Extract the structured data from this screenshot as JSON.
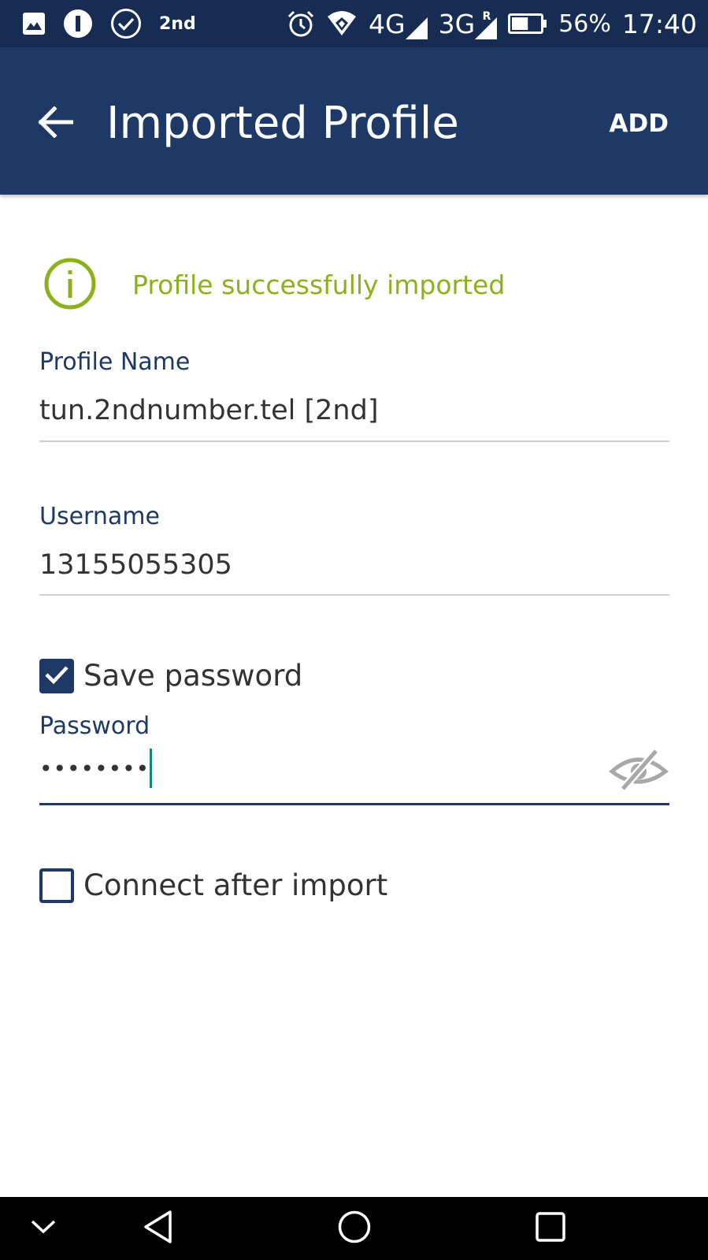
{
  "status_bar": {
    "notification_text": "2nd",
    "network_1": "4G",
    "network_2": "3G",
    "roaming_mark": "R",
    "battery_percent": "56%",
    "battery_level": 0.56,
    "time": "17:40",
    "icons": [
      "gallery-icon",
      "info-circle-icon",
      "check-circle-icon",
      "alarm-icon",
      "wifi-icon",
      "signal-icon",
      "signal-icon",
      "battery-icon"
    ]
  },
  "app_bar": {
    "title": "Imported Profile",
    "back_icon": "arrow-left-icon",
    "action_label": "ADD"
  },
  "notice": {
    "icon": "info-circle-icon",
    "text": "Profile successfully imported",
    "color": "#8bb11b"
  },
  "profile_name": {
    "label": "Profile Name",
    "value": "tun.2ndnumber.tel [2nd]"
  },
  "username": {
    "label": "Username",
    "value": "13155055305"
  },
  "save_password": {
    "label": "Save password",
    "checked": true
  },
  "password": {
    "label": "Password",
    "masked_value": "••••••••",
    "visibility_icon": "eye-off-icon"
  },
  "connect_after_import": {
    "label": "Connect after import",
    "checked": false
  },
  "nav_bar": {
    "buttons": [
      "chevron-down-icon",
      "back-triangle-icon",
      "home-circle-icon",
      "recents-square-icon"
    ]
  },
  "colors": {
    "status_bar": "#172c52",
    "app_bar": "#1e3966",
    "accent": "#1e3966",
    "success": "#8bb11b",
    "cursor": "#15857a"
  }
}
